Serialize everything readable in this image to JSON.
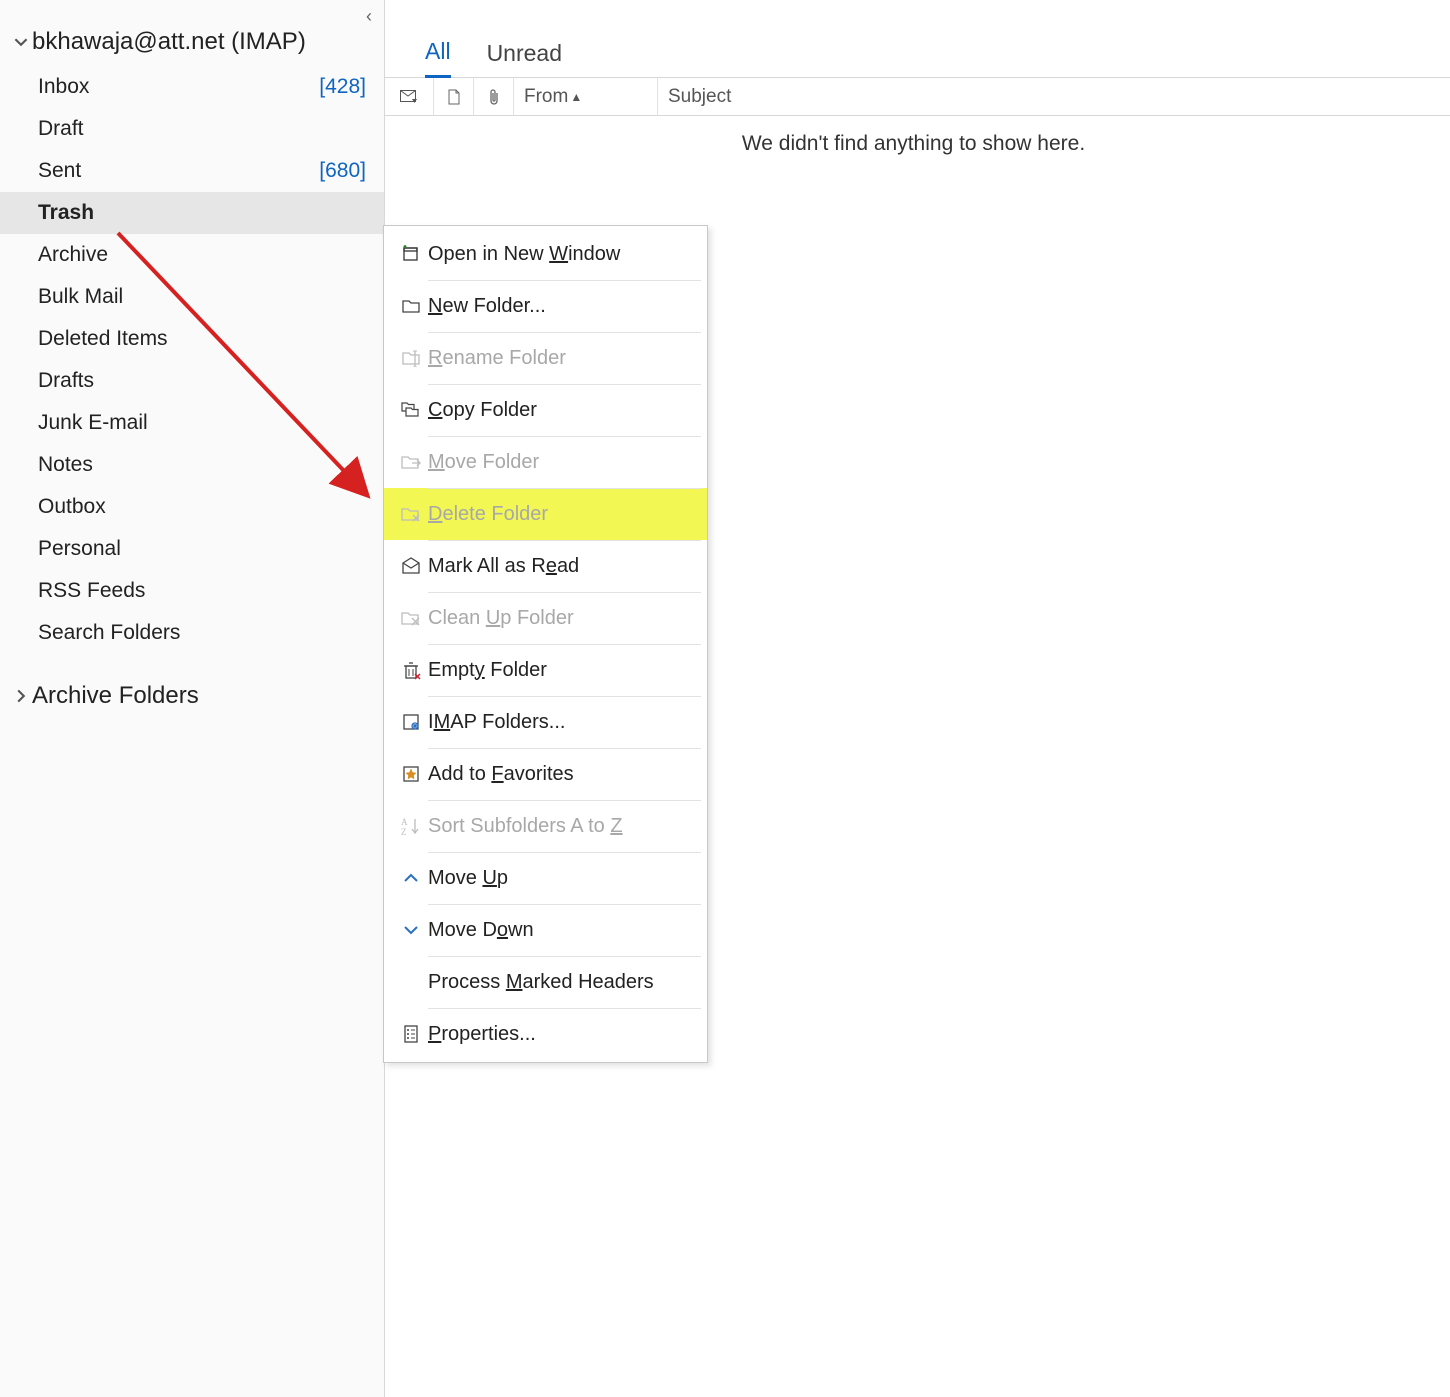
{
  "sidebar": {
    "account_label": "bkhawaja@att.net (IMAP)",
    "folders": [
      {
        "name": "Inbox",
        "count": "[428]",
        "selected": false
      },
      {
        "name": "Draft",
        "count": "",
        "selected": false
      },
      {
        "name": "Sent",
        "count": "[680]",
        "selected": false
      },
      {
        "name": "Trash",
        "count": "",
        "selected": true
      },
      {
        "name": "Archive",
        "count": "",
        "selected": false
      },
      {
        "name": "Bulk Mail",
        "count": "",
        "selected": false
      },
      {
        "name": "Deleted Items",
        "count": "",
        "selected": false
      },
      {
        "name": "Drafts",
        "count": "",
        "selected": false
      },
      {
        "name": "Junk E-mail",
        "count": "",
        "selected": false
      },
      {
        "name": "Notes",
        "count": "",
        "selected": false
      },
      {
        "name": "Outbox",
        "count": "",
        "selected": false
      },
      {
        "name": "Personal",
        "count": "",
        "selected": false
      },
      {
        "name": "RSS Feeds",
        "count": "",
        "selected": false
      },
      {
        "name": "Search Folders",
        "count": "",
        "selected": false
      }
    ],
    "archive_group_label": "Archive Folders"
  },
  "main": {
    "tabs": {
      "all": "All",
      "unread": "Unread"
    },
    "columns": {
      "from": "From",
      "subject": "Subject"
    },
    "empty_message": "We didn't find anything to show here."
  },
  "context_menu": {
    "items": [
      {
        "label_pre": "Open in New ",
        "ul": "W",
        "label_post": "indow",
        "icon": "new-window",
        "disabled": false,
        "highlight": false
      },
      {
        "label_pre": "",
        "ul": "N",
        "label_post": "ew Folder...",
        "icon": "folder",
        "disabled": false,
        "highlight": false
      },
      {
        "label_pre": "",
        "ul": "R",
        "label_post": "ename Folder",
        "icon": "folder-rename",
        "disabled": true,
        "highlight": false
      },
      {
        "label_pre": "",
        "ul": "C",
        "label_post": "opy Folder",
        "icon": "folder-copy",
        "disabled": false,
        "highlight": false
      },
      {
        "label_pre": "",
        "ul": "M",
        "label_post": "ove Folder",
        "icon": "folder-move",
        "disabled": true,
        "highlight": false
      },
      {
        "label_pre": "",
        "ul": "D",
        "label_post": "elete Folder",
        "icon": "folder-delete",
        "disabled": true,
        "highlight": true
      },
      {
        "label_pre": "Mark All as R",
        "ul": "e",
        "label_post": "ad",
        "icon": "mark-read",
        "disabled": false,
        "highlight": false
      },
      {
        "label_pre": "Clean ",
        "ul": "U",
        "label_post": "p Folder",
        "icon": "folder-clean",
        "disabled": true,
        "highlight": false
      },
      {
        "label_pre": "Empt",
        "ul": "y",
        "label_post": " Folder",
        "icon": "folder-empty",
        "disabled": false,
        "highlight": false
      },
      {
        "label_pre": "I",
        "ul": "M",
        "label_post": "AP Folders...",
        "icon": "imap",
        "disabled": false,
        "highlight": false
      },
      {
        "label_pre": "Add to ",
        "ul": "F",
        "label_post": "avorites",
        "icon": "favorite",
        "disabled": false,
        "highlight": false
      },
      {
        "label_pre": "Sort Subfolders A to ",
        "ul": "Z",
        "label_post": "",
        "icon": "sort-az",
        "disabled": true,
        "highlight": false
      },
      {
        "label_pre": "Move ",
        "ul": "U",
        "label_post": "p",
        "icon": "chevron-up",
        "disabled": false,
        "highlight": false
      },
      {
        "label_pre": "Move D",
        "ul": "o",
        "label_post": "wn",
        "icon": "chevron-down",
        "disabled": false,
        "highlight": false
      },
      {
        "label_pre": "Process ",
        "ul": "M",
        "label_post": "arked Headers",
        "icon": "",
        "disabled": false,
        "highlight": false
      },
      {
        "label_pre": "",
        "ul": "P",
        "label_post": "roperties...",
        "icon": "properties",
        "disabled": false,
        "highlight": false
      }
    ]
  }
}
